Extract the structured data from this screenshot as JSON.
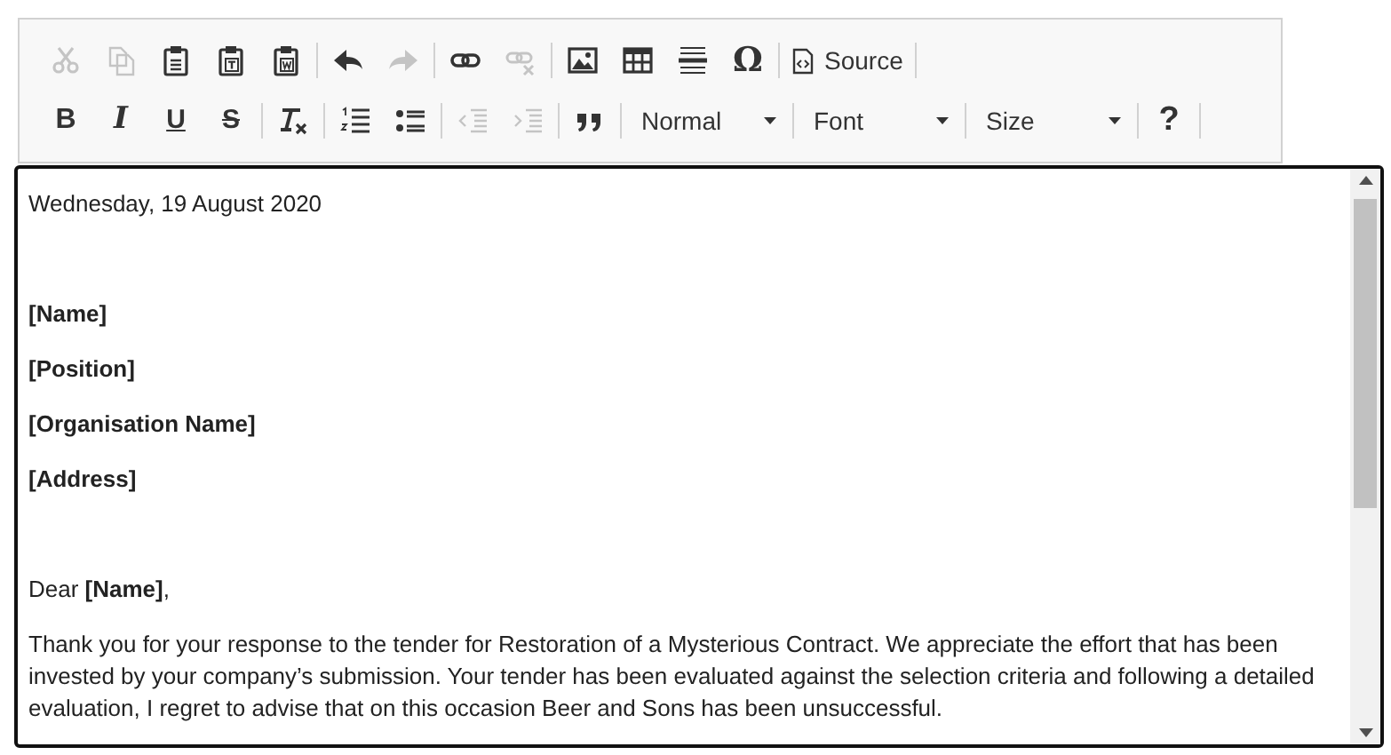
{
  "toolbar": {
    "rows": [
      {
        "groups": [
          [
            {
              "kind": "icon",
              "disabled": true
            },
            {
              "kind": "icon",
              "disabled": true
            },
            {
              "kind": "icon",
              "disabled": false
            },
            {
              "kind": "icon",
              "disabled": false
            },
            {
              "kind": "icon",
              "disabled": false
            }
          ],
          [
            {
              "kind": "icon",
              "disabled": false
            },
            {
              "kind": "icon",
              "disabled": true
            }
          ],
          [
            {
              "kind": "icon",
              "disabled": false
            },
            {
              "kind": "icon",
              "disabled": true
            }
          ],
          [
            {
              "kind": "icon",
              "disabled": false
            },
            {
              "kind": "icon",
              "disabled": false
            },
            {
              "kind": "icon",
              "disabled": false
            },
            {
              "kind": "glyph",
              "label": "Ω",
              "disabled": false
            }
          ],
          [
            {
              "kind": "icon-text",
              "label": "Source",
              "disabled": false
            }
          ]
        ]
      },
      {
        "groups": [
          [
            {
              "kind": "glyph",
              "label": "B",
              "disabled": false
            },
            {
              "kind": "glyph",
              "label": "I",
              "disabled": false
            },
            {
              "kind": "glyph",
              "label": "U",
              "disabled": false
            },
            {
              "kind": "glyph",
              "label": "S",
              "disabled": false
            }
          ],
          [
            {
              "kind": "icon",
              "disabled": false
            }
          ],
          [
            {
              "kind": "icon",
              "disabled": false
            },
            {
              "kind": "icon",
              "disabled": false
            }
          ],
          [
            {
              "kind": "icon",
              "disabled": true
            },
            {
              "kind": "icon",
              "disabled": true
            }
          ],
          [
            {
              "kind": "icon",
              "disabled": false
            }
          ],
          [
            {
              "kind": "dropdown",
              "label": "Normal"
            }
          ],
          [
            {
              "kind": "dropdown",
              "label": "Font"
            }
          ],
          [
            {
              "kind": "dropdown",
              "label": "Size"
            }
          ],
          [
            {
              "kind": "glyph",
              "label": "?",
              "disabled": false
            }
          ]
        ]
      }
    ]
  },
  "document": {
    "date": "Wednesday, 19 August 2020",
    "recipient": [
      "[Name]",
      "[Position]",
      "[Organisation Name]",
      "[Address]"
    ],
    "salutation": "Dear **[Name]**,",
    "body": [
      "Thank you for your response to the tender for Restoration of a Mysterious Contract. We appreciate the effort that has been invested by your company’s submission. Your tender has been evaluated against the selection criteria and following a detailed evaluation, I regret to advise that on this occasion Beer and Sons has been unsuccessful."
    ]
  }
}
